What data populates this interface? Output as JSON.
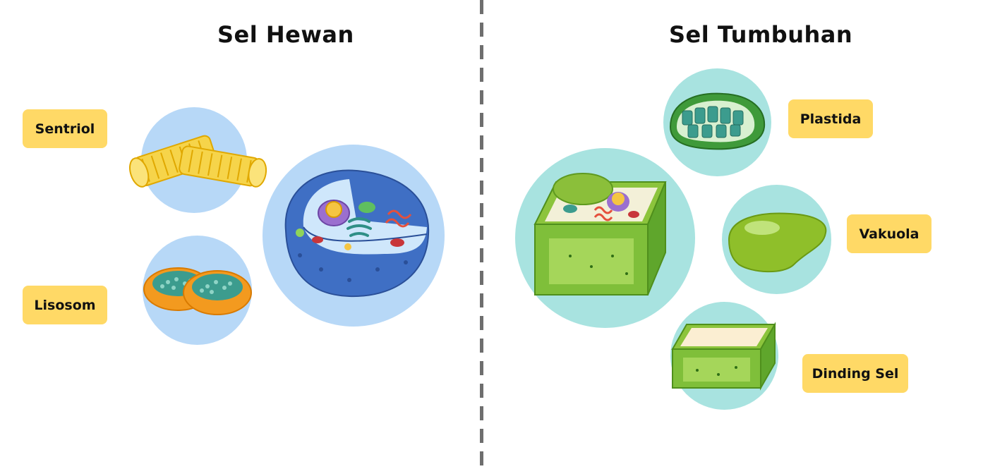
{
  "animal": {
    "title": "Sel Hewan",
    "labels": {
      "sentriol": "Sentriol",
      "lisosom": "Lisosom"
    }
  },
  "plant": {
    "title": "Sel Tumbuhan",
    "labels": {
      "plastida": "Plastida",
      "vakuola": "Vakuola",
      "dinding_sel": "Dinding Sel"
    }
  },
  "colors": {
    "label_bg": "#ffd966",
    "animal_circle": "#b7d8f7",
    "plant_circle": "#a8e3e0",
    "divider": "#6e6e6e"
  }
}
